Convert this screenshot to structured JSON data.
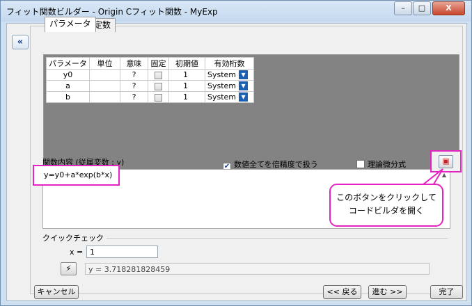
{
  "window": {
    "title": "フィット関数ビルダー - Origin Cフィット関数 - MyExp",
    "title_buttons": {
      "minimize": "–",
      "maximize": "□",
      "close": "X"
    }
  },
  "collapse_button": "«",
  "tabs": [
    {
      "label": "パラメータ",
      "active": true
    },
    {
      "label": "定数",
      "active": false
    }
  ],
  "param_table": {
    "headers": [
      "パラメータ",
      "単位",
      "意味",
      "固定",
      "初期値",
      "有効桁数"
    ],
    "rows": [
      {
        "name": "y0",
        "unit": "",
        "meaning": "?",
        "fixed": false,
        "initial": "1",
        "sig": "System"
      },
      {
        "name": "a",
        "unit": "",
        "meaning": "?",
        "fixed": false,
        "initial": "1",
        "sig": "System"
      },
      {
        "name": "b",
        "unit": "",
        "meaning": "?",
        "fixed": false,
        "initial": "1",
        "sig": "System"
      }
    ]
  },
  "function_body": {
    "label": "関数内容 (従属変数 : y)",
    "formula": "y=y0+a*exp(b*x)"
  },
  "options": {
    "double_precision_label": "数値全てを倍精度で扱う",
    "double_precision_checked": true,
    "analytic_derivative_label": "理論微分式",
    "analytic_derivative_checked": false
  },
  "callout": {
    "line1": "このボタンをクリックして",
    "line2": "コードビルダを開く"
  },
  "quick_check": {
    "label": "クイックチェック",
    "x_label": "x =",
    "x_value": "1",
    "result": "y = 3.718281828459"
  },
  "footer": {
    "cancel": "キャンセル",
    "back": "<< 戻る",
    "next": "進む >>",
    "finish": "完了"
  },
  "colors": {
    "highlight": "#e523c2",
    "frame": "#cfe0f1",
    "tab_area": "#838383"
  }
}
